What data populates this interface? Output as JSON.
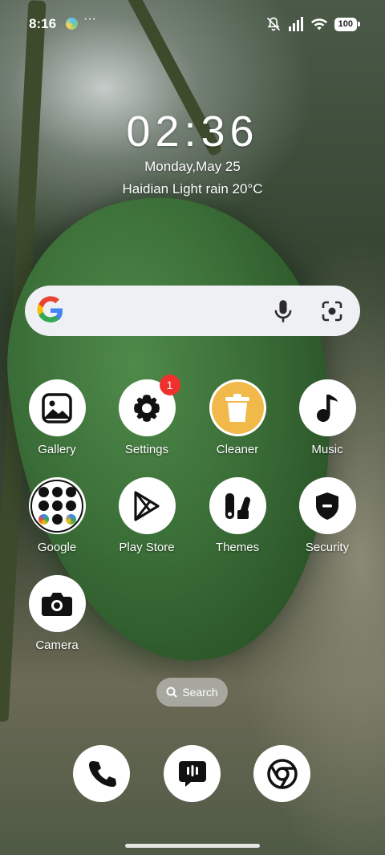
{
  "status_bar": {
    "time": "8:16",
    "dots": "···",
    "battery": "100"
  },
  "lockinfo": {
    "clock": "02:36",
    "date": "Monday,May 25",
    "weather": "Haidian Light rain 20°C"
  },
  "apps": [
    {
      "label": "Gallery"
    },
    {
      "label": "Settings",
      "badge": "1"
    },
    {
      "label": "Cleaner"
    },
    {
      "label": "Music"
    },
    {
      "label": "Google"
    },
    {
      "label": "Play Store"
    },
    {
      "label": "Themes"
    },
    {
      "label": "Security"
    },
    {
      "label": "Camera"
    }
  ],
  "drawer_search": {
    "label": "Search"
  },
  "dock": [
    "phone",
    "messages",
    "chrome"
  ],
  "colors": {
    "badge": "#f0302d",
    "cleaner_accent": "#f0b94a",
    "searchbar_bg": "#eef0f4"
  }
}
